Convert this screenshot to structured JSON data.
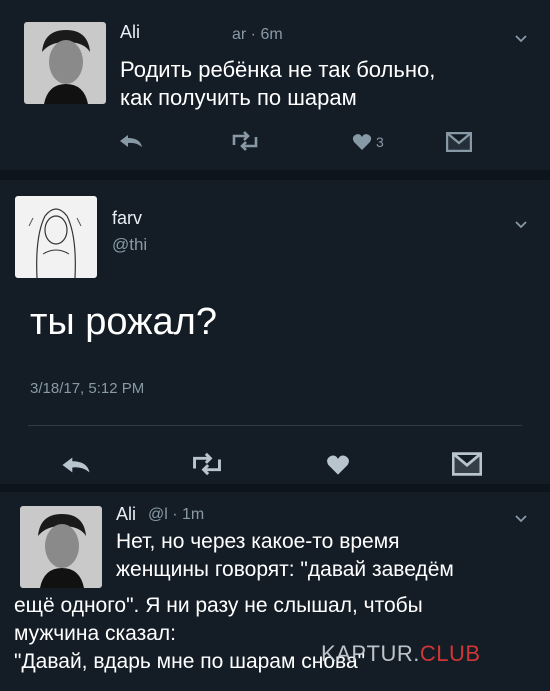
{
  "tweet1": {
    "name": "Ali",
    "meta": "ar · 6m",
    "text_line1": "Родить ребёнка не так больно,",
    "text_line2": "как получить по шарам",
    "like_count": "3"
  },
  "tweet2": {
    "name": "farv",
    "handle": "@thi",
    "text": "ты рожал?",
    "timestamp": "3/18/17, 5:12 PM"
  },
  "tweet3": {
    "name": "Ali",
    "handle_time": "@l · 1m",
    "text_line1": "Нет, но через какое-то время",
    "text_line2": "женщины говорят: \"давай заведём",
    "text_line3": "ещё одного\". Я ни разу не слышал, чтобы",
    "text_line4": "мужчина сказал:",
    "text_line5": "\"Давай, вдарь мне по шарам снова\""
  },
  "watermark": {
    "part1": "KAPTUR.",
    "part2": "CLUB"
  },
  "colors": {
    "background": "#141d26",
    "secondary_text": "#8899a6",
    "icon": "#8899a6",
    "icon_light": "#b8c4ce"
  },
  "icons": [
    "reply-icon",
    "retweet-icon",
    "like-icon",
    "dm-icon",
    "chevron-down-icon"
  ]
}
